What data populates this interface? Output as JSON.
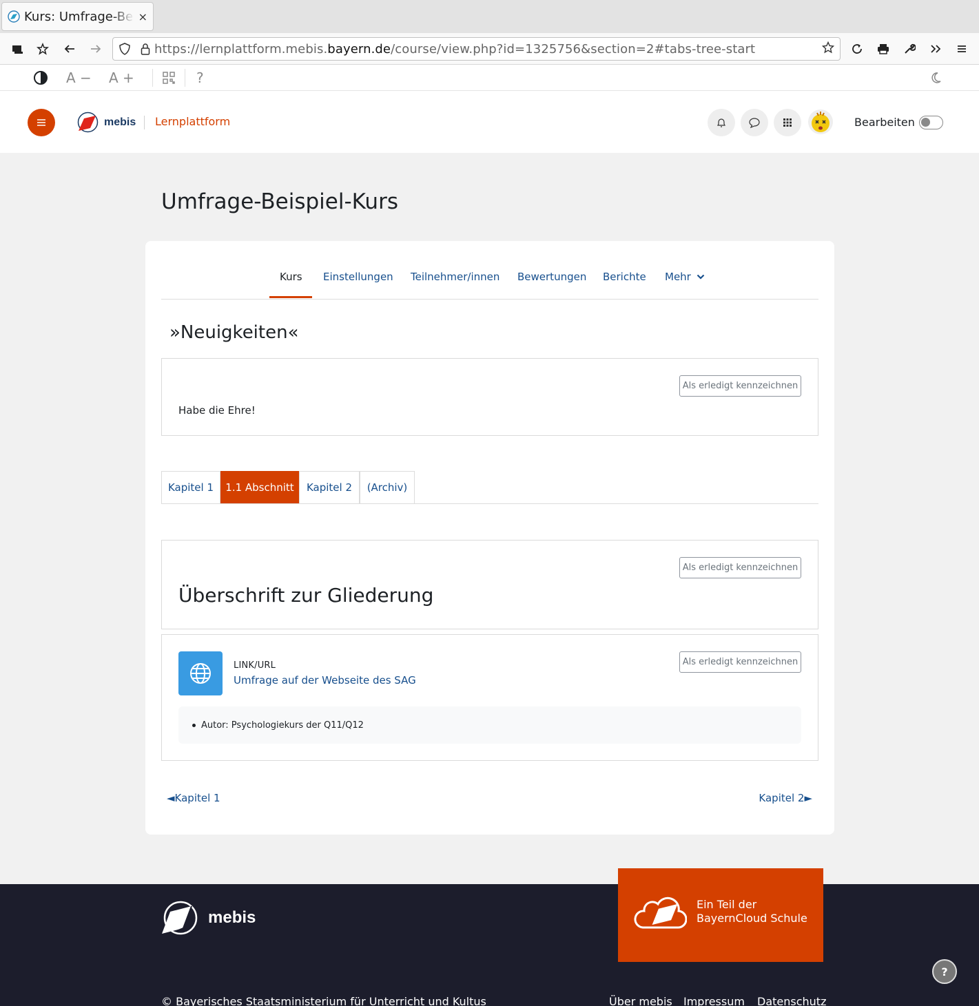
{
  "browser": {
    "tab_title": "Kurs: Umfrage-Beispiel-Kurs",
    "tab_close": "×",
    "url_prefix": "https://lernplattform.mebis.",
    "url_domain": "bayern.de",
    "url_path": "/course/view.php?id=1325756&section=2#tabs-tree-start"
  },
  "accessibility": {
    "font_decrease": "A −",
    "font_increase": "A +",
    "help": "?"
  },
  "header": {
    "logo_text": "mebis",
    "platform": "Lernplattform",
    "edit_label": "Bearbeiten",
    "edit_mode": false
  },
  "course": {
    "title": "Umfrage-Beispiel-Kurs",
    "nav": [
      {
        "label": "Kurs",
        "active": true
      },
      {
        "label": "Einstellungen"
      },
      {
        "label": "Teilnehmer/innen"
      },
      {
        "label": "Bewertungen"
      },
      {
        "label": "Berichte"
      },
      {
        "label": "Mehr"
      }
    ]
  },
  "news": {
    "heading": "»Neuigkeiten«",
    "done_label": "Als erledigt kennzeichnen",
    "text": "Habe die Ehre!"
  },
  "section_tabs": [
    {
      "label": "Kapitel 1"
    },
    {
      "label": "1.1 Abschnitt",
      "active": true
    },
    {
      "label": "Kapitel 2"
    },
    {
      "label": "(Archiv)"
    }
  ],
  "section": {
    "heading": "Überschrift zur Gliederung",
    "done_label": "Als erledigt kennzeichnen"
  },
  "activity": {
    "type": "LINK/URL",
    "title": "Umfrage auf der Webseite des SAG",
    "done_label": "Als erledigt kennzeichnen",
    "info": "Autor: Psychologiekurs der Q11/Q12"
  },
  "pager": {
    "prev": "◄Kapitel 1",
    "next": "Kapitel 2►"
  },
  "footer": {
    "logo_text": "mebis",
    "cloud_line1": "Ein Teil der",
    "cloud_line2": "BayernCloud Schule",
    "copyright": "© Bayerisches Staatsministerium für Unterricht und Kultus",
    "links": [
      "Über mebis",
      "Impressum",
      "Datenschutz"
    ],
    "help": "?"
  },
  "colors": {
    "brand_orange": "#d44000",
    "link_blue": "#174f8d",
    "footer_bg": "#1c1d2c",
    "activity_icon_bg": "#399be2"
  }
}
